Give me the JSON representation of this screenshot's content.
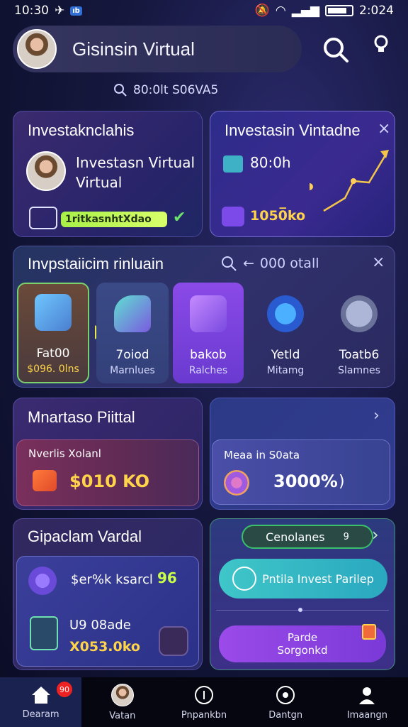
{
  "status_bar": {
    "time": "10:30",
    "badge": "ıb",
    "right_time": "2:024"
  },
  "header": {
    "title": "Gisinsin Virtual"
  },
  "subsearch": {
    "text": "80:0lt S06VA5"
  },
  "card_invest": {
    "title": "Investaknclahis",
    "name_line1": "Investasn Virtual",
    "name_line2": "Virtual",
    "pill": "1ritkasnhtXdao"
  },
  "card_chart": {
    "title": "Investasin Vintadne",
    "value1": "80:0h",
    "value2": "1050̅ko"
  },
  "strip": {
    "title": "Invpstaiicim rinluain",
    "search_text": "000 otall",
    "tiles": [
      {
        "l1": "Fat00",
        "l2": "$096. 0lns"
      },
      {
        "l1": "7oiod",
        "l2": "Marnlues"
      },
      {
        "l1": "bakob",
        "l2": "Ralches"
      },
      {
        "l1": "Yetld",
        "l2": "Mitamg"
      },
      {
        "l1": "Toatb6",
        "l2": "Slamnes"
      }
    ]
  },
  "card_portal": {
    "title": "Mnartaso Piittal",
    "label": "Nverlis Xolanl",
    "amount": "$010 KO"
  },
  "card_meta": {
    "label": "Meaa in S0ata",
    "amount": "3000%",
    "paren": ")"
  },
  "card_virtual": {
    "title": "Gipaclam Vardal",
    "row1_text": "$er%k ksarcl",
    "row1_badge": "96",
    "row2_label": "U9 08ade",
    "row2_amount": "X053.0ko"
  },
  "card_actions": {
    "top_pill": "Cenolanes",
    "top_pill_num": "9",
    "invest_button": "Pntila Invest Parilep",
    "bottom_button_l1": "Parde",
    "bottom_button_l2": "Sorgonkd"
  },
  "bottom_nav": {
    "badge": "90",
    "items": [
      "Dearam",
      "Vatan",
      "Pnpankbn",
      "Dantgn",
      "Imaangn"
    ]
  },
  "colors": {
    "accent_green": "#a8f048",
    "accent_purple": "#7b4ae8",
    "accent_teal": "#3ec6c6"
  }
}
